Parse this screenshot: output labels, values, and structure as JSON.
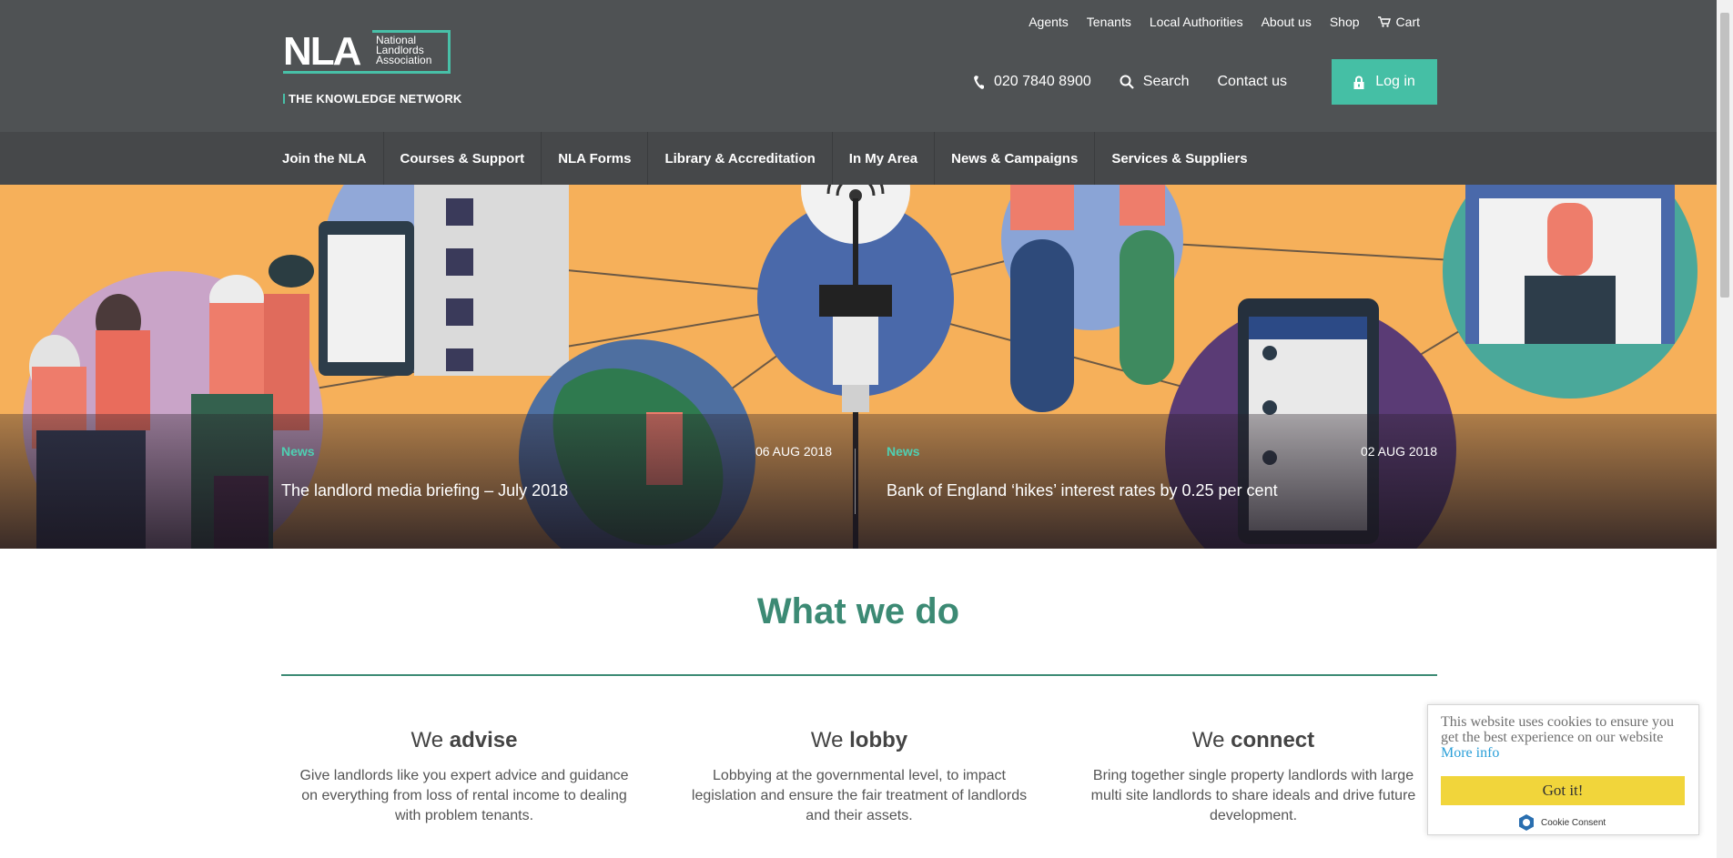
{
  "header": {
    "logo": {
      "wordmark": "NLA",
      "association": "National\nLandlords\nAssociation",
      "tagline": "THE KNOWLEDGE NETWORK"
    },
    "top_links": [
      "Agents",
      "Tenants",
      "Local Authorities",
      "About us",
      "Shop",
      "Cart"
    ],
    "phone": "020 7840 8900",
    "search_label": "Search",
    "contact_label": "Contact us",
    "login_label": "Log in"
  },
  "nav": {
    "items": [
      "Join the NLA",
      "Courses & Support",
      "NLA Forms",
      "Library & Accreditation",
      "In My Area",
      "News & Campaigns",
      "Services & Suppliers"
    ]
  },
  "hero": {
    "cards": [
      {
        "tag": "News",
        "date": "06 AUG 2018",
        "title": "The landlord media briefing – July 2018"
      },
      {
        "tag": "News",
        "date": "02 AUG 2018",
        "title": "Bank of England ‘hikes’ interest rates by 0.25 per cent"
      }
    ]
  },
  "what_we_do": {
    "title": "What we do",
    "columns": [
      {
        "prefix": "We",
        "bold": "advise",
        "text": "Give landlords like you expert advice and guidance on everything from loss of rental income to dealing with problem tenants."
      },
      {
        "prefix": "We",
        "bold": "lobby",
        "text": "Lobbying at the governmental level, to impact legislation and ensure the fair treatment of landlords and their assets."
      },
      {
        "prefix": "We",
        "bold": "connect",
        "text": "Bring together single property landlords with large multi site landlords to share ideals and drive future development."
      }
    ]
  },
  "cookie": {
    "message": "This website uses cookies to ensure you get the best experience on our website",
    "more_info": "More info",
    "button": "Got it!",
    "brand": "Cookie Consent"
  },
  "colors": {
    "header_bg": "#4f5254",
    "nav_bg": "#46484a",
    "accent": "#45bfa5",
    "hero_bg": "#f6b05a",
    "heading_green": "#3c8a74",
    "cookie_button": "#f1d53b"
  }
}
